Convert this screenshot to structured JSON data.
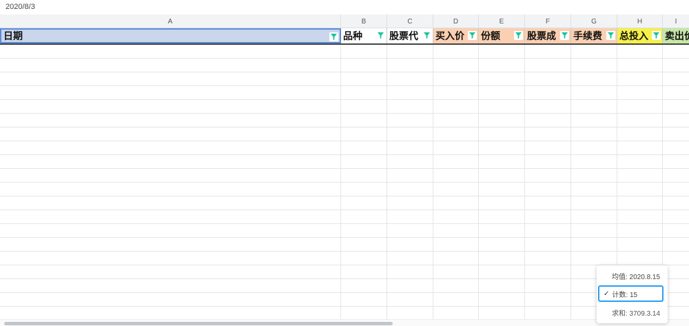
{
  "formula_bar": {
    "value": "2020/8/3"
  },
  "columns": [
    {
      "letter": "A",
      "field": "日期"
    },
    {
      "letter": "B",
      "field": "品种"
    },
    {
      "letter": "C",
      "field": "股票代"
    },
    {
      "letter": "D",
      "field": "买入价"
    },
    {
      "letter": "E",
      "field": "份额"
    },
    {
      "letter": "F",
      "field": "股票成"
    },
    {
      "letter": "G",
      "field": "手续费"
    },
    {
      "letter": "H",
      "field": "总投入"
    },
    {
      "letter": "I",
      "field": "卖出价"
    }
  ],
  "colors": {
    "date_header": "#c9d6ec",
    "plain_header": "#ffffff",
    "peach_header": "#fbd0b2",
    "yellow_header": "#f6f04a",
    "green_header": "#c6e7a8",
    "filter_icon": "#19c39d",
    "selection_border": "#2b9ff2"
  },
  "icons": {
    "filter": "filter-funnel-icon",
    "check": "checkmark-icon"
  },
  "stats": {
    "average": "均值: 2020.8.15",
    "count": "计数: 15",
    "sum": "求和: 3709.3.14",
    "count_checked": "✓"
  }
}
